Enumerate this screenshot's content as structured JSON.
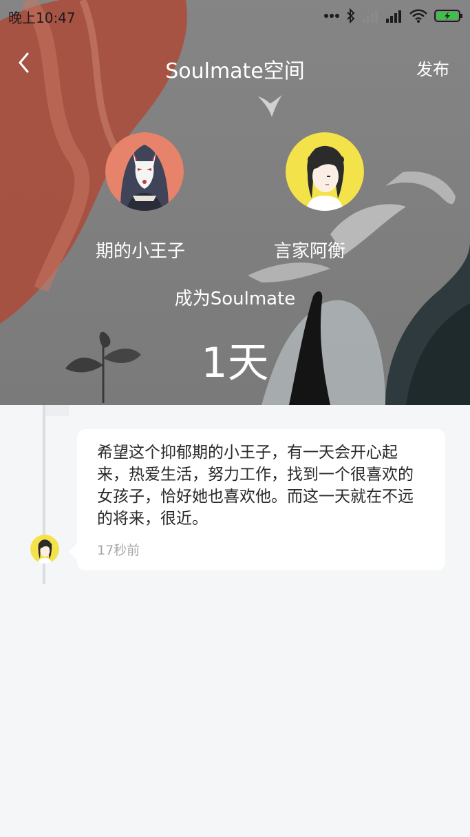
{
  "status_bar": {
    "time": "晚上10:47",
    "icons": [
      "dots-icon",
      "bluetooth-icon",
      "signal-icon",
      "signal-icon",
      "wifi-icon",
      "battery-charging-icon"
    ]
  },
  "header": {
    "back_icon": "chevron-left-icon",
    "title": "Soulmate空间",
    "publish_label": "发布"
  },
  "soulmates": {
    "left_name": "期的小王子",
    "right_name": "言家阿衡",
    "become_text": "成为Soulmate",
    "days": "1天"
  },
  "post": {
    "text": "希望这个抑郁期的小王子，有一天会开心起来，热爱生活，努力工作，找到一个很喜欢的女孩子，恰好她也喜欢他。而这一天就在不远的将来，很近。",
    "time": "17秒前"
  },
  "colors": {
    "background": "#f5f6f8",
    "card": "#ffffff",
    "text": "#2a2a2a",
    "muted": "#a6a6a6",
    "avatar_ring_right": "#f3e24a",
    "avatar_ring_left": "#e6836a"
  }
}
